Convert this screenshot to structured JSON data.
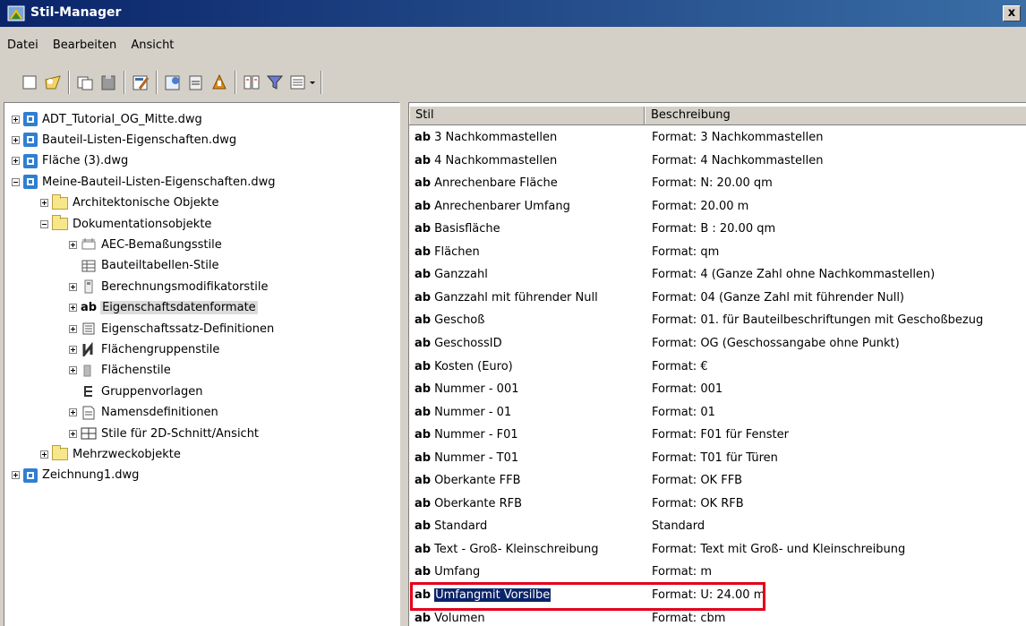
{
  "window": {
    "title": "Stil-Manager",
    "close_label": "x"
  },
  "menu": [
    "Datei",
    "Bearbeiten",
    "Ansicht"
  ],
  "toolbar": {
    "buttons": [
      "new-icon",
      "open-icon",
      "copy-icon",
      "paste-icon",
      "edit-icon",
      "purge-icon",
      "import-icon",
      "export-icon",
      "compare-icon",
      "filter-icon",
      "view-icon"
    ]
  },
  "tree": [
    {
      "label": "ADT_Tutorial_OG_Mitte.dwg",
      "level": 0,
      "expander": "plus",
      "icon": "dwg"
    },
    {
      "label": "Bauteil-Listen-Eigenschaften.dwg",
      "level": 0,
      "expander": "plus",
      "icon": "dwg"
    },
    {
      "label": "Fläche (3).dwg",
      "level": 0,
      "expander": "plus",
      "icon": "dwg"
    },
    {
      "label": "Meine-Bauteil-Listen-Eigenschaften.dwg",
      "level": 0,
      "expander": "minus",
      "icon": "dwg"
    },
    {
      "label": "Architektonische Objekte",
      "level": 1,
      "expander": "plus",
      "icon": "folder"
    },
    {
      "label": "Dokumentationsobjekte",
      "level": 1,
      "expander": "minus",
      "icon": "folder"
    },
    {
      "label": "AEC-Bemaßungsstile",
      "level": 2,
      "expander": "plus",
      "icon": "dim"
    },
    {
      "label": "Bauteiltabellen-Stile",
      "level": 2,
      "expander": "none",
      "icon": "table"
    },
    {
      "label": "Berechnungsmodifikatorstile",
      "level": 2,
      "expander": "plus",
      "icon": "calc"
    },
    {
      "label": "Eigenschaftsdatenformate",
      "level": 2,
      "expander": "plus",
      "icon": "ab",
      "highlight": true
    },
    {
      "label": "Eigenschaftssatz-Definitionen",
      "level": 2,
      "expander": "plus",
      "icon": "list"
    },
    {
      "label": "Flächengruppenstile",
      "level": 2,
      "expander": "plus",
      "icon": "areagroup"
    },
    {
      "label": "Flächenstile",
      "level": 2,
      "expander": "plus",
      "icon": "area"
    },
    {
      "label": "Gruppenvorlagen",
      "level": 2,
      "expander": "none",
      "icon": "groups"
    },
    {
      "label": "Namensdefinitionen",
      "level": 2,
      "expander": "plus",
      "icon": "doc"
    },
    {
      "label": "Stile für 2D-Schnitt/Ansicht",
      "level": 2,
      "expander": "plus",
      "icon": "section"
    },
    {
      "label": "Mehrzweckobjekte",
      "level": 1,
      "expander": "plus",
      "icon": "folder"
    },
    {
      "label": "Zeichnung1.dwg",
      "level": 0,
      "expander": "plus",
      "icon": "dwg"
    }
  ],
  "grid": {
    "headers": [
      "Stil",
      "Beschreibung"
    ],
    "rows": [
      {
        "style": "3 Nachkommastellen",
        "desc": "Format: 3 Nachkommastellen"
      },
      {
        "style": "4 Nachkommastellen",
        "desc": "Format: 4 Nachkommastellen"
      },
      {
        "style": "Anrechenbare Fläche",
        "desc": "Format: N: 20.00 qm"
      },
      {
        "style": "Anrechenbarer Umfang",
        "desc": "Format: 20.00 m"
      },
      {
        "style": "Basisfläche",
        "desc": "Format: B : 20.00 qm"
      },
      {
        "style": "Flächen",
        "desc": "Format: qm"
      },
      {
        "style": "Ganzzahl",
        "desc": "Format: 4 (Ganze Zahl ohne Nachkommastellen)"
      },
      {
        "style": "Ganzzahl mit führender Null",
        "desc": "Format: 04 (Ganze Zahl mit führender Null)"
      },
      {
        "style": "Geschoß",
        "desc": "Format: 01. für Bauteilbeschriftungen mit Geschoßbezug"
      },
      {
        "style": "GeschossID",
        "desc": "Format: OG (Geschossangabe ohne Punkt)"
      },
      {
        "style": "Kosten (Euro)",
        "desc": "Format: €"
      },
      {
        "style": "Nummer - 001",
        "desc": "Format: 001"
      },
      {
        "style": "Nummer - 01",
        "desc": "Format: 01"
      },
      {
        "style": "Nummer - F01",
        "desc": "Format: F01 für Fenster"
      },
      {
        "style": "Nummer - T01",
        "desc": "Format: T01 für Türen"
      },
      {
        "style": "Oberkante FFB",
        "desc": "Format:  OK FFB"
      },
      {
        "style": "Oberkante RFB",
        "desc": "Format: OK RFB"
      },
      {
        "style": "Standard",
        "desc": "Standard"
      },
      {
        "style": "Text - Groß- Kleinschreibung",
        "desc": "Format: Text mit Groß- und Kleinschreibung"
      },
      {
        "style": "Umfang",
        "desc": "Format: m"
      },
      {
        "style": "Umfangmit Vorsilbe",
        "desc": "Format: U: 24.00 m",
        "selected": true
      },
      {
        "style": "Volumen",
        "desc": "Format: cbm"
      }
    ],
    "ab_prefix": "ab"
  },
  "colors": {
    "titlebar": "#0a246a",
    "selection": "#0a246a",
    "callout": "#e3001b"
  }
}
